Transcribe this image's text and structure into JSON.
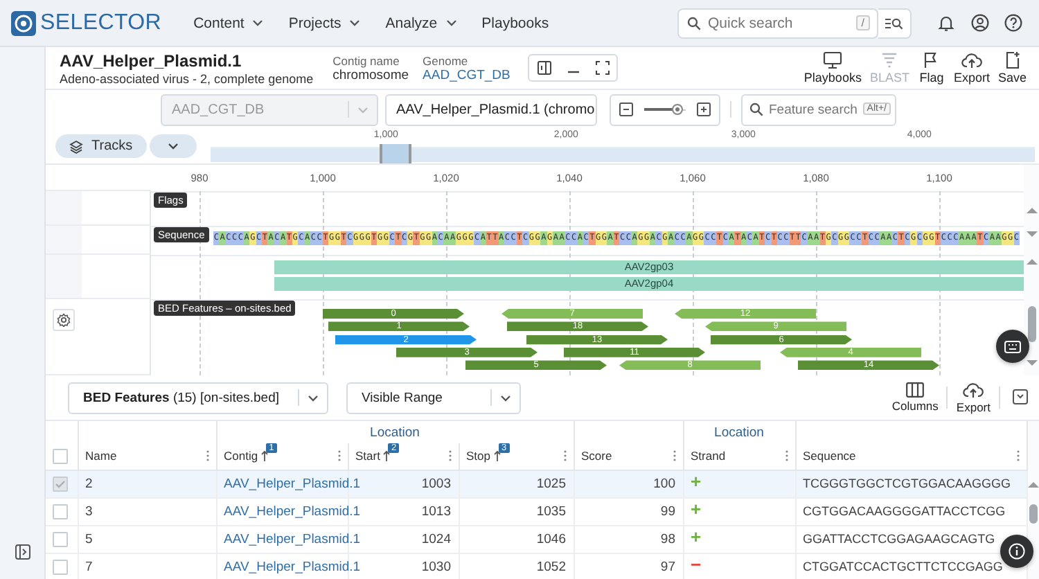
{
  "nav": {
    "logo": "SELECTOR",
    "menus": [
      {
        "label": "Content",
        "dropdown": true
      },
      {
        "label": "Projects",
        "dropdown": true
      },
      {
        "label": "Analyze",
        "dropdown": true
      },
      {
        "label": "Playbooks",
        "dropdown": false
      }
    ],
    "search": {
      "placeholder": "Quick search",
      "shortcut": "/"
    }
  },
  "header": {
    "title": "AAV_Helper_Plasmid.1",
    "subtitle": "Adeno-associated virus - 2, complete genome",
    "contig_label": "Contig name",
    "contig": "chromosome",
    "genome_label": "Genome",
    "genome": "AAD_CGT_DB",
    "actions": [
      {
        "label": "Playbooks",
        "kind": "monitor",
        "disabled": false
      },
      {
        "label": "BLAST",
        "kind": "blast",
        "disabled": true
      },
      {
        "label": "Flag",
        "kind": "flag",
        "disabled": false
      },
      {
        "label": "Export",
        "kind": "export",
        "disabled": false
      },
      {
        "label": "Save",
        "kind": "save",
        "disabled": false
      }
    ]
  },
  "controls": {
    "database": {
      "value": "AAD_CGT_DB",
      "disabled": true
    },
    "contig": {
      "value": "AAV_Helper_Plasmid.1 (chromo",
      "disabled": false
    },
    "zoom": {
      "level": 0.8
    },
    "feature_search": {
      "placeholder": "Feature search",
      "shortcut": "Alt+/"
    }
  },
  "overview": {
    "tracks_button": "Tracks",
    "ticks": [
      "1,000",
      "2,000",
      "3,000",
      "4,000"
    ]
  },
  "ruler": {
    "ticks": [
      "980",
      "1,000",
      "1,020",
      "1,040",
      "1,060",
      "1,080",
      "1,100"
    ]
  },
  "tracks": [
    {
      "kind": "flags",
      "label": "Flags"
    },
    {
      "kind": "sequence",
      "label": "Sequence",
      "bases": "CACCCAGCTACATGCACCTGGTCGGGTGGCTCGTGGACAAGGGCATTACCTCGGAGAACCACTGGATCCAGGACGACCAGGCCTCATACATCTCCTTCAATGCGGCCTCCAACTCGCGGTCCCAAATCAAGGC"
    },
    {
      "kind": "genes",
      "genes": [
        "AAV2gp03",
        "AAV2gp04"
      ]
    },
    {
      "kind": "features",
      "label": "BED Features – on-sites.bed",
      "features": [
        {
          "name": "0",
          "kind": "forward",
          "selected": false
        },
        {
          "name": "7",
          "kind": "reverse",
          "selected": false
        },
        {
          "name": "12",
          "kind": "reverse",
          "selected": false
        },
        {
          "name": "1",
          "kind": "forward",
          "selected": false
        },
        {
          "name": "18",
          "kind": "forward",
          "selected": false
        },
        {
          "name": "9",
          "kind": "reverse",
          "selected": false
        },
        {
          "name": "2",
          "kind": "forward",
          "selected": true
        },
        {
          "name": "13",
          "kind": "forward",
          "selected": false
        },
        {
          "name": "6",
          "kind": "forward",
          "selected": false
        },
        {
          "name": "3",
          "kind": "forward",
          "selected": false
        },
        {
          "name": "11",
          "kind": "forward",
          "selected": false
        },
        {
          "name": "4",
          "kind": "reverse",
          "selected": false
        },
        {
          "name": "5",
          "kind": "forward",
          "selected": false
        },
        {
          "name": "8",
          "kind": "reverse",
          "selected": false
        },
        {
          "name": "14",
          "kind": "forward",
          "selected": false
        }
      ]
    }
  ],
  "table_toolbar": {
    "source": "**BED Features** (15) [on-sites.bed]",
    "range": "Visible Range",
    "actions": [
      {
        "label": "Columns",
        "kind": "columns"
      },
      {
        "label": "Export",
        "kind": "export"
      }
    ]
  },
  "table": {
    "all_checked": false,
    "groups": [
      {
        "label": "Location"
      },
      {
        "label": "Location"
      }
    ],
    "columns": [
      {
        "label": "Name"
      },
      {
        "label": "Contig",
        "sort": "1"
      },
      {
        "label": "Start",
        "sort": "2"
      },
      {
        "label": "Stop",
        "sort": "3"
      },
      {
        "label": "Score"
      },
      {
        "label": "Strand"
      },
      {
        "label": "Sequence"
      }
    ],
    "rows": [
      {
        "selected": true,
        "checked": true,
        "name": "2",
        "contig": "AAV_Helper_Plasmid.1",
        "start": "1003",
        "stop": "1025",
        "score": "100",
        "strand": "+",
        "sequence": "TCGGGTGGCTCGTGGACAAGGGG"
      },
      {
        "selected": false,
        "checked": false,
        "name": "3",
        "contig": "AAV_Helper_Plasmid.1",
        "start": "1013",
        "stop": "1035",
        "score": "99",
        "strand": "+",
        "sequence": "CGTGGACAAGGGGATTACCTCGG"
      },
      {
        "selected": false,
        "checked": false,
        "name": "5",
        "contig": "AAV_Helper_Plasmid.1",
        "start": "1024",
        "stop": "1046",
        "score": "98",
        "strand": "+",
        "sequence": "GGATTACCTCGGAGAAGCAGTG"
      },
      {
        "selected": false,
        "checked": false,
        "name": "7",
        "contig": "AAV_Helper_Plasmid.1",
        "start": "1030",
        "stop": "1052",
        "score": "97",
        "strand": "−",
        "sequence": "CTGGATCCACTGCTTCTCCGAGG"
      }
    ]
  }
}
